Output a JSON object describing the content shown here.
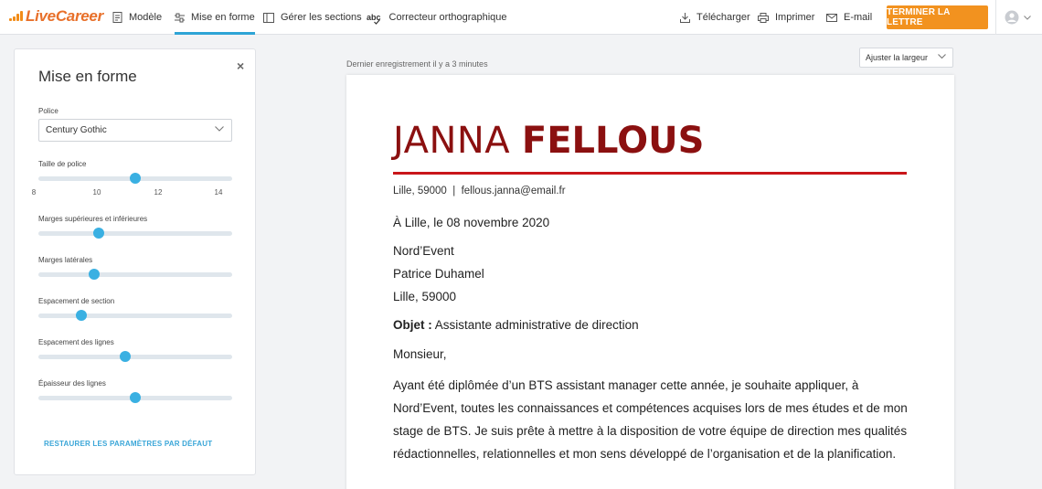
{
  "brand": {
    "name": "LiveCareer",
    "accent": "#e8702a",
    "primary": "#2ea4d6",
    "cta": "#f2921f"
  },
  "nav": {
    "modele": "Modèle",
    "mise_en_forme": "Mise en forme",
    "gerer_sections": "Gérer les sections",
    "correcteur": "Correcteur orthographique",
    "correcteur_icon_text": "abc",
    "telecharger": "Télécharger",
    "imprimer": "Imprimer",
    "email": "E-mail",
    "terminer": "TERMINER LA LETTRE"
  },
  "panel": {
    "title": "Mise en forme",
    "close": "×",
    "police_label": "Police",
    "police_value": "Century Gothic",
    "taille_label": "Taille de police",
    "taille_ticks": [
      "8",
      "10",
      "12",
      "14"
    ],
    "taille_value": 11.3,
    "marges_sup_label": "Marges supérieures et inférieures",
    "marges_sup_value": 0.31,
    "marges_lat_label": "Marges latérales",
    "marges_lat_value": 0.29,
    "espacement_section_label": "Espacement de section",
    "espacement_section_value": 0.22,
    "espacement_lignes_label": "Espacement des lignes",
    "espacement_lignes_value": 0.45,
    "epaisseur_label": "Épaisseur des lignes",
    "epaisseur_value": 0.5,
    "restore": "RESTAURER LES PARAMÈTRES PAR DÉFAUT"
  },
  "editor": {
    "last_saved": "Dernier enregistrement il y a 3 minutes",
    "zoom": "Ajuster la largeur"
  },
  "letter": {
    "first_name": "JANNA",
    "last_name": "FELLOUS",
    "contact": "Lille, 59000  |  fellous.janna@email.fr",
    "date": "À Lille, le 08 novembre 2020",
    "recipient_company": "Nord’Event",
    "recipient_name": "Patrice Duhamel",
    "recipient_city": "Lille, 59000",
    "subject_label": "Objet :",
    "subject": " Assistante administrative de direction",
    "salutation": "Monsieur,",
    "body": "Ayant été diplômée d’un BTS assistant manager cette année, je souhaite appliquer, à Nord’Event, toutes les connaissances et compétences acquises lors de mes études et de mon stage de BTS. Je suis prête à mettre à la disposition de votre équipe de direction mes qualités rédactionnelles, relationnelles et mon sens développé de l’organisation et de la planification.",
    "name_color": "#8b1010",
    "rule_color": "#c9161a"
  }
}
